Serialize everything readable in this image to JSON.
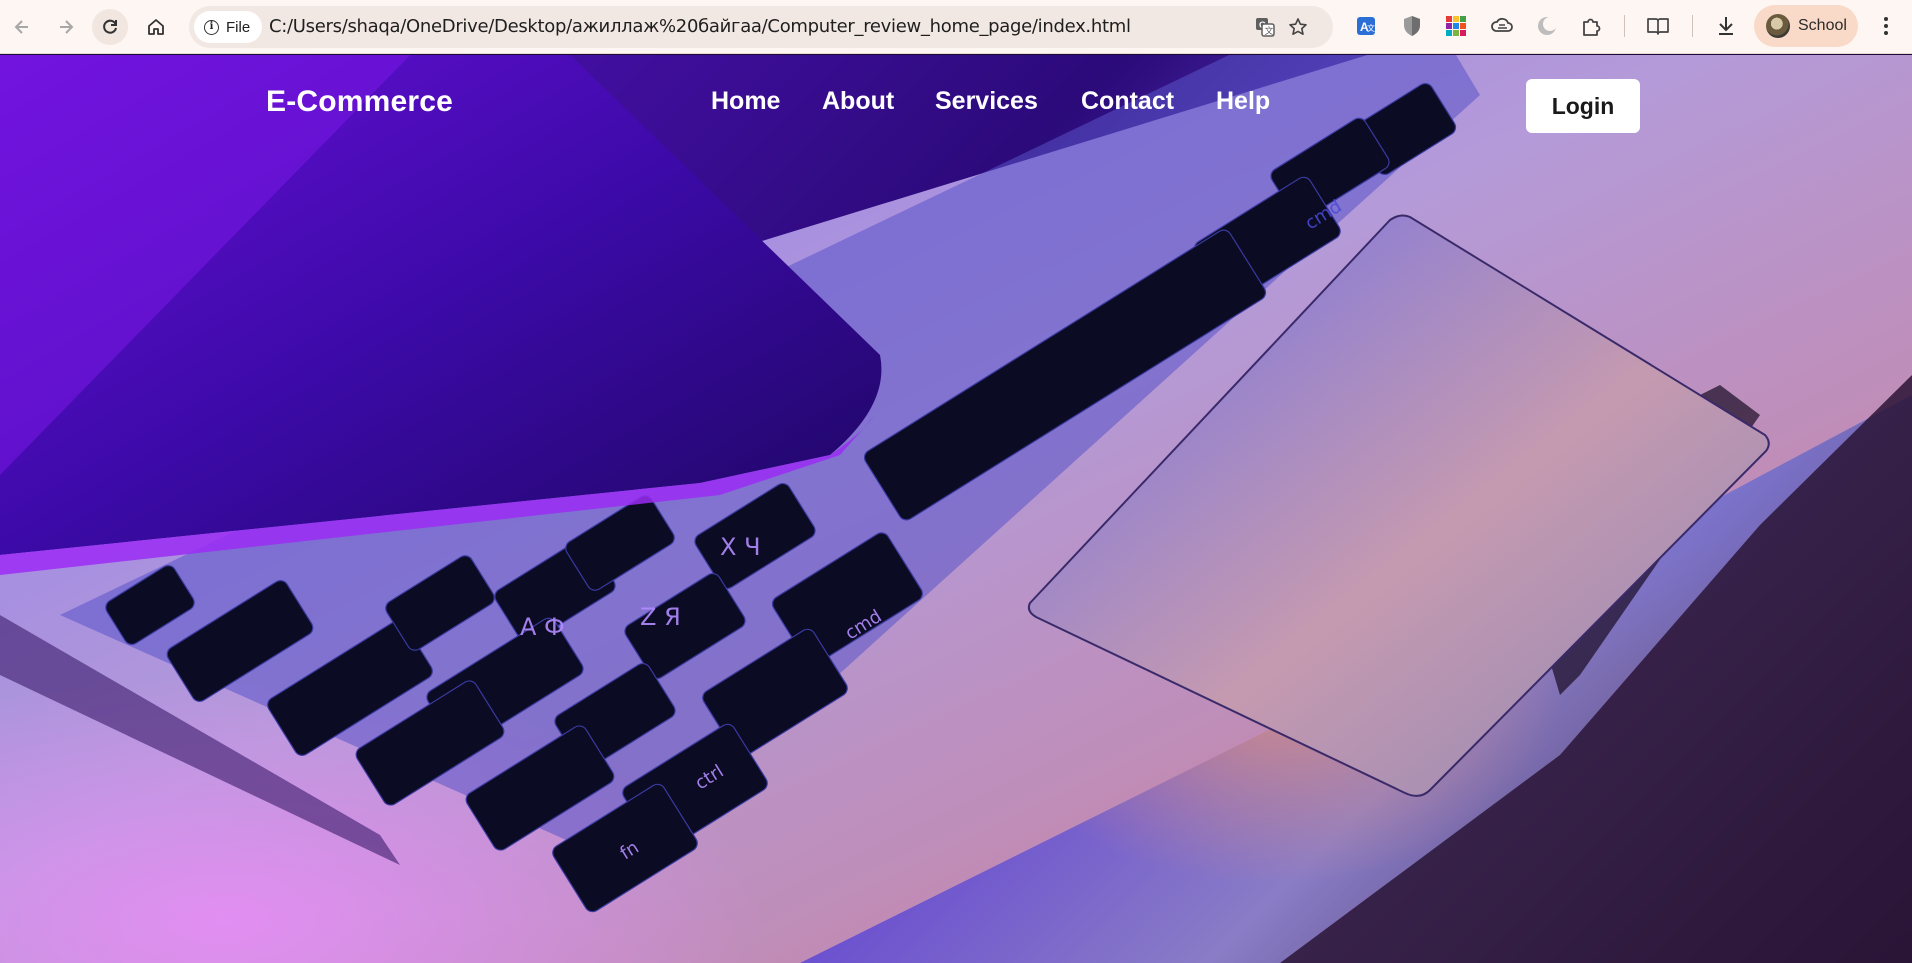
{
  "browser": {
    "url_chip_label": "File",
    "url": "C:/Users/shaqa/OneDrive/Desktop/ажиллаж%20байгаа/Computer_review_home_page/index.html",
    "profile_label": "School",
    "icons": [
      "back-icon",
      "forward-icon",
      "reload-icon",
      "home-icon",
      "info-icon",
      "translate-icon",
      "star-icon",
      "translator-extension-icon",
      "shield-extension-icon",
      "palette-extension-icon",
      "cloud-extension-icon",
      "moon-extension-icon",
      "puzzle-icon",
      "reading-mode-icon",
      "download-icon",
      "profile-avatar",
      "menu-dots-icon"
    ]
  },
  "site": {
    "logo": "E-Commerce",
    "nav": {
      "home": "Home",
      "about": "About",
      "services": "Services",
      "contact": "Contact",
      "help": "Help"
    },
    "login_label": "Login"
  }
}
